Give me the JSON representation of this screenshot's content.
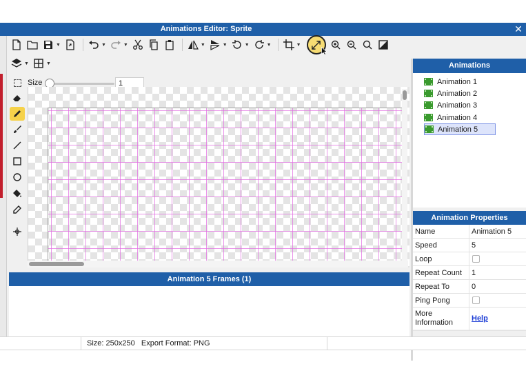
{
  "window": {
    "title": "Animations Editor: Sprite",
    "close_glyph": "✕"
  },
  "toolbar": {
    "row1": [
      "new-icon",
      "open-folder-icon",
      "save-icon",
      "export-icon",
      "undo-icon",
      "redo-icon",
      "cut-icon",
      "copy-icon",
      "paste-icon",
      "flip-horizontal-icon",
      "flip-vertical-icon",
      "rotate-left-icon",
      "rotate-right-icon",
      "crop-icon",
      "fit-to-window-icon",
      "zoom-in-icon",
      "zoom-out-icon",
      "zoom-reset-icon",
      "toggle-background-icon"
    ],
    "row2": [
      "layers-icon",
      "grid-icon"
    ],
    "active_tool": "fit-to-window-icon"
  },
  "size_control": {
    "label": "Size",
    "value": "1",
    "slider_fraction": 0.0
  },
  "tools": [
    "eraser-icon",
    "pencil-icon",
    "brush-icon",
    "line-icon",
    "rectangle-icon",
    "ellipse-icon",
    "fill-bucket-icon",
    "eyedropper-icon",
    "move-icon"
  ],
  "selected_tool": "pencil-icon",
  "frames_panel": {
    "title": "Animation 5 Frames (1)",
    "frame_count": "0"
  },
  "animations_panel": {
    "title": "Animations",
    "items": [
      {
        "label": "Animation 1",
        "selected": false
      },
      {
        "label": "Animation 2",
        "selected": false
      },
      {
        "label": "Animation 3",
        "selected": false
      },
      {
        "label": "Animation 4",
        "selected": false
      },
      {
        "label": "Animation 5",
        "selected": true
      }
    ]
  },
  "properties_panel": {
    "title": "Animation Properties",
    "rows": [
      {
        "key": "Name",
        "value": "Animation 5",
        "type": "text"
      },
      {
        "key": "Speed",
        "value": "5",
        "type": "text"
      },
      {
        "key": "Loop",
        "value": "",
        "type": "checkbox",
        "checked": false
      },
      {
        "key": "Repeat Count",
        "value": "1",
        "type": "text"
      },
      {
        "key": "Repeat To",
        "value": "0",
        "type": "text"
      },
      {
        "key": "Ping Pong",
        "value": "",
        "type": "checkbox",
        "checked": false
      },
      {
        "key": "More Information",
        "value": "Help",
        "type": "link"
      }
    ]
  },
  "status_bar": {
    "size_info": "Size: 250x250",
    "export_format": "Export Format: PNG"
  },
  "colors": {
    "header_blue": "#1f5fa8",
    "grid_magenta": "#e270e2",
    "active_tool_yellow": "#f6d24a",
    "film_icon_green": "#3a9a2e"
  }
}
